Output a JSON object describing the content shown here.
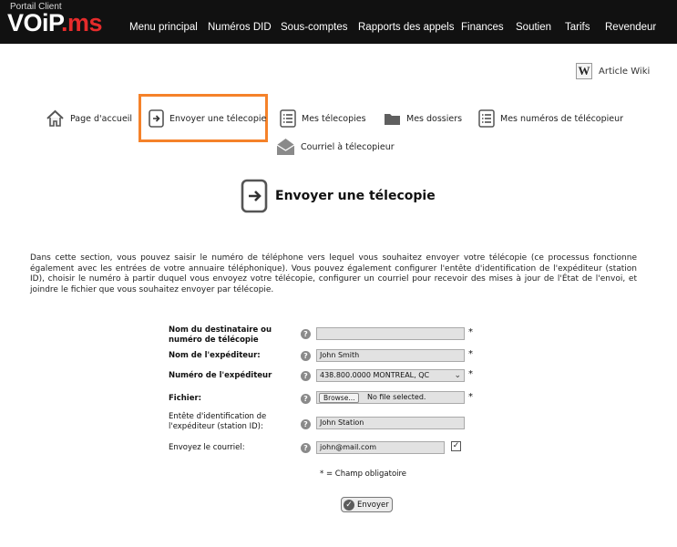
{
  "header": {
    "logo_subtitle": "Portail Client",
    "logo_white": "VOiP",
    "logo_red": ".ms",
    "nav": [
      "Menu principal",
      "Numéros DID",
      "Sous-comptes",
      "Rapports des appels",
      "Finances",
      "Soutien",
      "Tarifs",
      "Revendeur"
    ]
  },
  "wiki": {
    "icon_letter": "W",
    "label": "Article Wiki"
  },
  "quick_links": {
    "home": "Page d'accueil",
    "send_fax": "Envoyer une télecopie",
    "my_faxes": "Mes télecopies",
    "my_folders": "Mes dossiers",
    "my_fax_numbers": "Mes numéros de télécopieur",
    "email_to_fax": "Courriel à télecopieur"
  },
  "page": {
    "title": "Envoyer une télecopie",
    "description": "Dans cette section, vous pouvez saisir le numéro de téléphone vers lequel vous souhaitez envoyer votre télécopie (ce processus fonctionne également avec les entrées de votre annuaire téléphonique). Vous pouvez également configurer l'entête d'identification de l'expéditeur (station ID), choisir le numéro à partir duquel vous envoyez votre télécopie, configurer un courriel pour recevoir des mises à jour de l'État de l'envoi, et joindre le fichier que vous souhaitez envoyer par télécopie."
  },
  "form": {
    "recipient_label": "Nom du destinataire ou numéro de télécopie",
    "recipient_value": "",
    "sender_name_label": "Nom de l'expéditeur:",
    "sender_name_value": "John Smith",
    "sender_number_label": "Numéro de l'expéditeur",
    "sender_number_value": "438.800.0000 MONTREAL, QC",
    "file_label": "Fichier:",
    "browse_label": "Browse...",
    "file_status": "No file selected.",
    "station_label": "Entête d'identification de l'expéditeur (station ID):",
    "station_value": "John Station",
    "email_label": "Envoyez le courriel:",
    "email_value": "john@mail.com",
    "email_checked": true,
    "required_mark": "*",
    "help_glyph": "?",
    "required_note": "* = Champ obligatoire",
    "submit_label": "Envoyer"
  },
  "colors": {
    "topbar": "#111111",
    "brand_red": "#e52b2b",
    "highlight": "#f5822a"
  }
}
